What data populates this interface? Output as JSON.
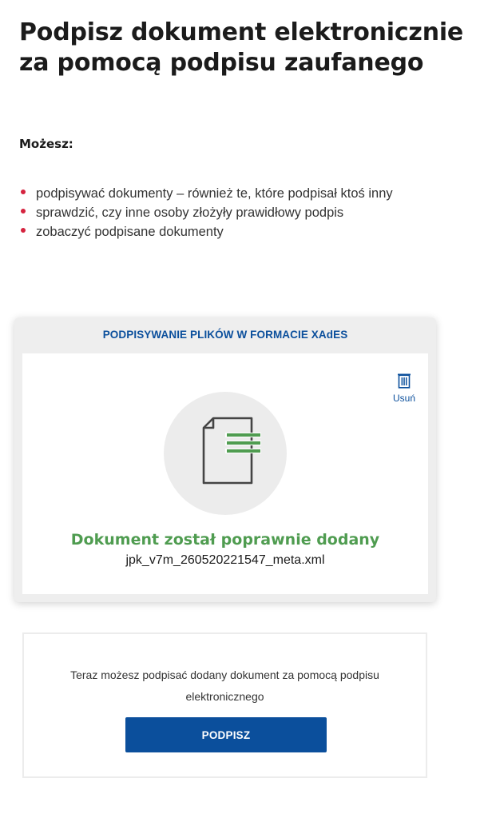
{
  "page": {
    "title_line1": "Podpisz dokument elektronicznie",
    "title_line2": "za pomocą podpisu zaufanego",
    "subheading": "Możesz:",
    "features": [
      "podpisywać dokumenty – również te, które podpisał ktoś inny",
      "sprawdzić, czy inne osoby złożyły prawidłowy podpis",
      "zobaczyć podpisane dokumenty"
    ]
  },
  "upload_card": {
    "header": "PODPISYWANIE PLIKÓW W FORMACIE XAdES",
    "delete_label": "Usuń",
    "delete_icon": "trash-icon",
    "document_icon": "document-icon",
    "success_message": "Dokument został poprawnie dodany",
    "file_name": "jpk_v7m_260520221547_meta.xml"
  },
  "sign_box": {
    "instruction": "Teraz możesz podpisać dodany dokument za pomocą podpisu elektronicznego",
    "button_label": "PODPISZ"
  },
  "colors": {
    "brand_blue": "#0b4f9c",
    "success_green": "#4f9c50",
    "bullet_red": "#d5233f"
  }
}
